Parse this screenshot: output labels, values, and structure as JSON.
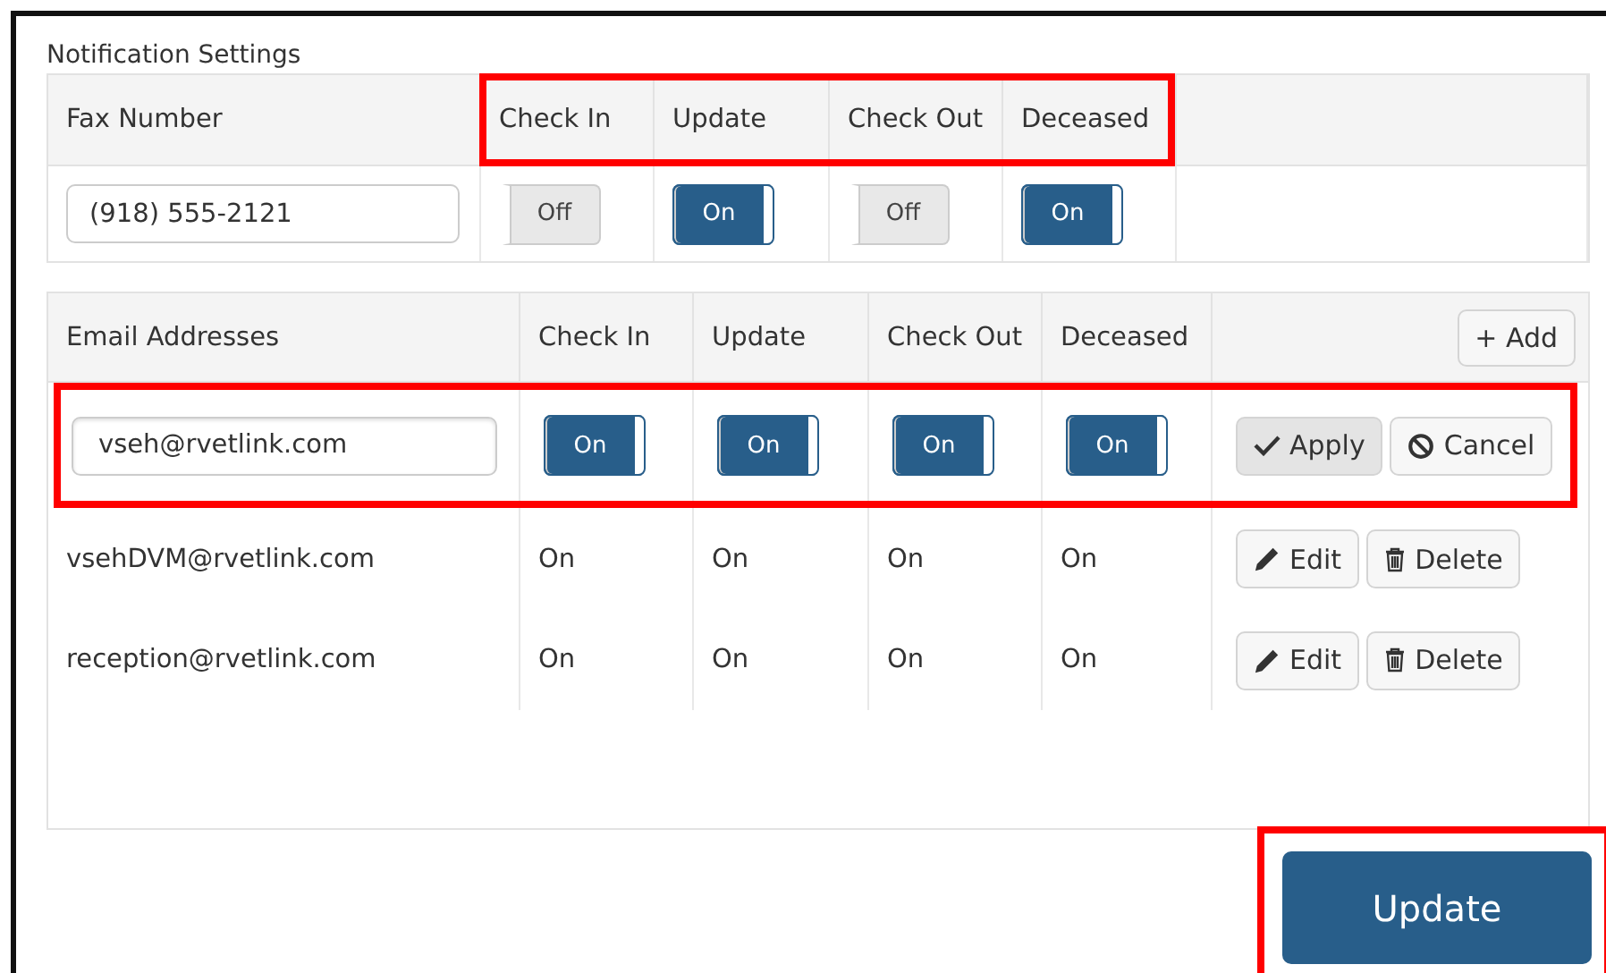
{
  "section_title": "Notification Settings",
  "fax_table": {
    "columns": [
      "Fax Number",
      "Check In",
      "Update",
      "Check Out",
      "Deceased"
    ],
    "status_columns_highlighted": true,
    "row": {
      "value": "(918) 555-2121",
      "toggles": [
        {
          "label": "Off",
          "on": false
        },
        {
          "label": "On",
          "on": true
        },
        {
          "label": "Off",
          "on": false
        },
        {
          "label": "On",
          "on": true
        }
      ]
    }
  },
  "email_table": {
    "columns": [
      "Email Addresses",
      "Check In",
      "Update",
      "Check Out",
      "Deceased"
    ],
    "add_button": "+ Add",
    "rows": [
      {
        "kind": "editing",
        "highlighted": true,
        "value": "vseh@rvetlink.com",
        "toggles": [
          {
            "label": "On",
            "on": true
          },
          {
            "label": "On",
            "on": true
          },
          {
            "label": "On",
            "on": true
          },
          {
            "label": "On",
            "on": true
          }
        ],
        "buttons": [
          {
            "kind": "apply",
            "label": "Apply"
          },
          {
            "kind": "cancel",
            "label": "Cancel"
          }
        ]
      },
      {
        "kind": "display",
        "email": "vsehDVM@rvetlink.com",
        "statuses": [
          "On",
          "On",
          "On",
          "On"
        ],
        "buttons": [
          {
            "kind": "edit",
            "label": "Edit"
          },
          {
            "kind": "delete",
            "label": "Delete"
          }
        ]
      },
      {
        "kind": "display",
        "email": "reception@rvetlink.com",
        "statuses": [
          "On",
          "On",
          "On",
          "On"
        ],
        "buttons": [
          {
            "kind": "edit",
            "label": "Edit"
          },
          {
            "kind": "delete",
            "label": "Delete"
          }
        ]
      }
    ]
  },
  "update_button": {
    "label": "Update",
    "highlighted": true
  }
}
